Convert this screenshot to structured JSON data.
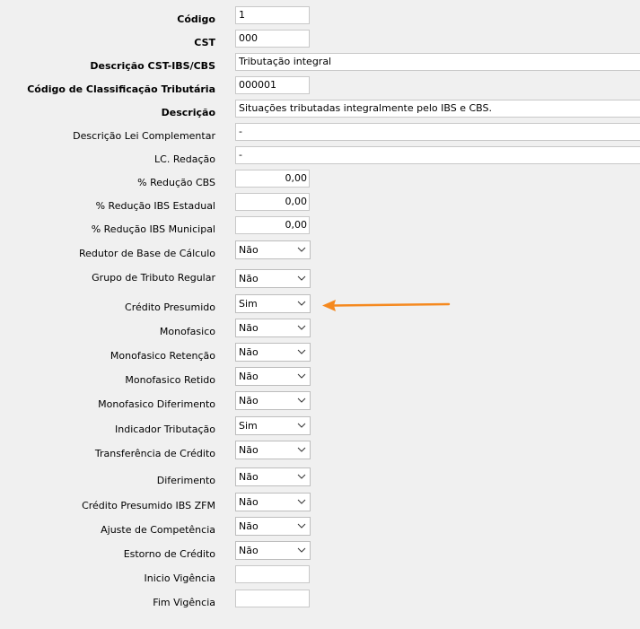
{
  "form": {
    "codigo": {
      "label": "Código",
      "value": "1"
    },
    "cst": {
      "label": "CST",
      "value": "000"
    },
    "descricao_cst": {
      "label": "Descrição CST-IBS/CBS",
      "value": "Tributação integral"
    },
    "codigo_classificacao": {
      "label": "Código de Classificação Tributária",
      "value": "000001"
    },
    "descricao": {
      "label": "Descrição",
      "value": "Situações tributadas integralmente pelo IBS e CBS."
    },
    "descricao_lei": {
      "label": "Descrição Lei Complementar",
      "value": "-"
    },
    "lc_redacao": {
      "label": "LC. Redação",
      "value": "-"
    },
    "reducao_cbs": {
      "label": "% Redução CBS",
      "value": "0,00"
    },
    "reducao_ibs_estadual": {
      "label": "% Redução IBS Estadual",
      "value": "0,00"
    },
    "reducao_ibs_municipal": {
      "label": "% Redução IBS Municipal",
      "value": "0,00"
    },
    "redutor_base": {
      "label": "Redutor de Base de Cálculo",
      "value": "Não"
    },
    "grupo_tributo": {
      "label": "Grupo de Tributo Regular",
      "value": "Não"
    },
    "credito_presumido": {
      "label": "Crédito Presumido",
      "value": "Sim"
    },
    "monofasico": {
      "label": "Monofasico",
      "value": "Não"
    },
    "monofasico_retencao": {
      "label": "Monofasico Retenção",
      "value": "Não"
    },
    "monofasico_retido": {
      "label": "Monofasico Retido",
      "value": "Não"
    },
    "monofasico_diferimento": {
      "label": "Monofasico Diferimento",
      "value": "Não"
    },
    "indicador_tributacao": {
      "label": "Indicador Tributação",
      "value": "Sim"
    },
    "transferencia_credito": {
      "label": "Transferência de Crédito",
      "value": "Não"
    },
    "diferimento": {
      "label": "Diferimento",
      "value": "Não"
    },
    "credito_presumido_zfm": {
      "label": "Crédito Presumido IBS ZFM",
      "value": "Não"
    },
    "ajuste_competencia": {
      "label": "Ajuste de Competência",
      "value": "Não"
    },
    "estorno_credito": {
      "label": "Estorno de Crédito",
      "value": "Não"
    },
    "inicio_vigencia": {
      "label": "Inicio Vigência",
      "value": ""
    },
    "fim_vigencia": {
      "label": "Fim Vigência",
      "value": ""
    }
  },
  "colors": {
    "arrow": "#f5891f",
    "field_border": "#c8c8c8",
    "background": "#f0f0f0"
  },
  "icons": {
    "dropdown": "chevron-down-icon",
    "annotation": "arrow-left-icon"
  }
}
